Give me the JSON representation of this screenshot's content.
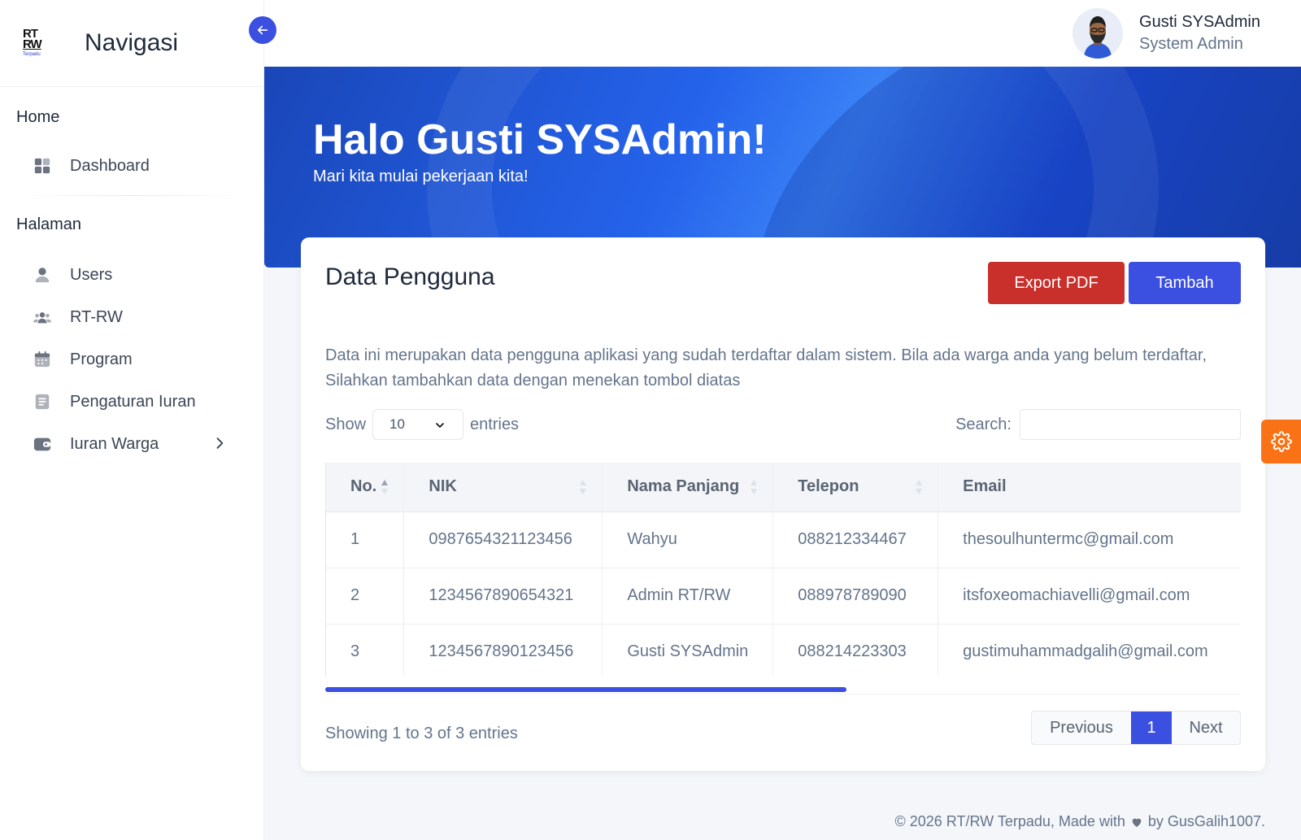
{
  "brand": {
    "logo_line1": "RT",
    "logo_line2": "RW",
    "logo_line3": "Terpadu",
    "title": "Navigasi"
  },
  "sidebar": {
    "sections": [
      {
        "title": "Home",
        "items": [
          {
            "label": "Dashboard",
            "icon": "grid-icon"
          }
        ]
      },
      {
        "title": "Halaman",
        "items": [
          {
            "label": "Users",
            "icon": "user-icon"
          },
          {
            "label": "RT-RW",
            "icon": "users-group-icon"
          },
          {
            "label": "Program",
            "icon": "calendar-icon"
          },
          {
            "label": "Pengaturan Iuran",
            "icon": "document-icon"
          },
          {
            "label": "Iuran Warga",
            "icon": "wallet-icon"
          }
        ]
      }
    ]
  },
  "user": {
    "name": "Gusti SYSAdmin",
    "role": "System Admin"
  },
  "hero": {
    "title": "Halo Gusti SYSAdmin!",
    "subtitle": "Mari kita mulai pekerjaan kita!"
  },
  "card": {
    "title": "Data Pengguna",
    "export_label": "Export PDF",
    "add_label": "Tambah",
    "description": "Data ini merupakan data pengguna aplikasi yang sudah terdaftar dalam sistem. Bila ada warga anda yang belum terdaftar, Silahkan tambahkan data dengan menekan tombol diatas"
  },
  "table_controls": {
    "show_label": "Show",
    "entries_value": "10",
    "entries_label": "entries",
    "search_label": "Search:"
  },
  "table": {
    "columns": [
      "No.",
      "NIK",
      "Nama Panjang",
      "Telepon",
      "Email"
    ],
    "rows": [
      [
        "1",
        "0987654321123456",
        "Wahyu",
        "088212334467",
        "thesoulhuntermc@gmail.com"
      ],
      [
        "2",
        "1234567890654321",
        "Admin RT/RW",
        "088978789090",
        "itsfoxeomachiavelli@gmail.com"
      ],
      [
        "3",
        "1234567890123456",
        "Gusti SYSAdmin",
        "088214223303",
        "gustimuhammadgalih@gmail.com"
      ]
    ]
  },
  "pagination": {
    "info": "Showing 1 to 3 of 3 entries",
    "previous": "Previous",
    "page": "1",
    "next": "Next"
  },
  "footer": {
    "left": "© 2026 RT/RW Terpadu, Made with",
    "right": "by GusGalih1007."
  },
  "colors": {
    "primary": "#3b4fe0",
    "danger": "#c9302c",
    "settings": "#f97316",
    "hero": "#2563eb"
  }
}
